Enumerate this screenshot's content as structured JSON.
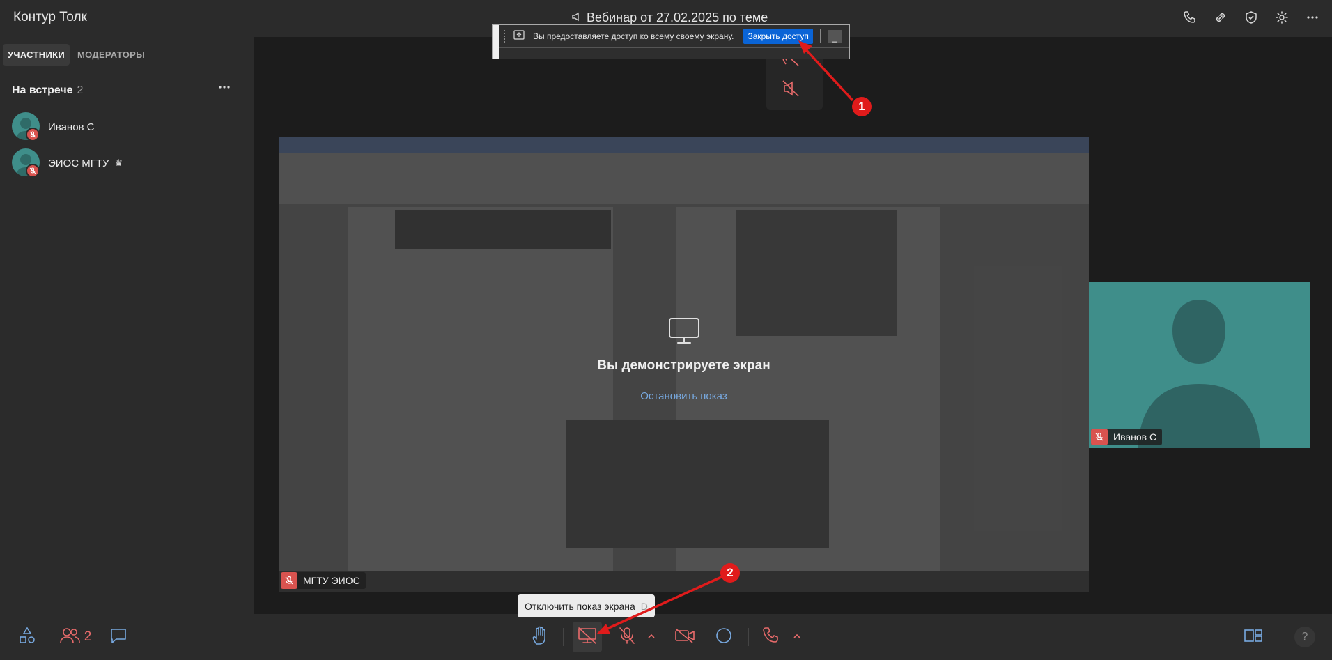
{
  "app": {
    "title": "Контур Толк"
  },
  "meeting": {
    "title": "Вебинар от 27.02.2025 по теме"
  },
  "header_icons": [
    "phone-icon",
    "link-icon",
    "shield-check-icon",
    "gear-icon",
    "more-icon"
  ],
  "sidebar": {
    "tabs": [
      {
        "label": "УЧАСТНИКИ",
        "active": true
      },
      {
        "label": "МОДЕРАТОРЫ",
        "active": false
      }
    ],
    "section": {
      "title": "На встрече",
      "count": "2"
    },
    "participants": [
      {
        "name": "Иванов С",
        "muted": true
      },
      {
        "name": "ЭИОС МГТУ",
        "muted": true,
        "host": true,
        "host_icon": "♛"
      }
    ]
  },
  "share_banner": {
    "message": "Вы предоставляете доступ ко всему своему экрану.",
    "close_label": "Закрыть доступ",
    "minimize_label": "_"
  },
  "screen_share": {
    "title": "Вы демонстрируете экран",
    "stop_label": "Остановить показ",
    "owner": "МГТУ ЭИОС"
  },
  "video_tile": {
    "name": "Иванов С"
  },
  "toolbar": {
    "participants_count": "2",
    "tooltip": "Отключить показ экрана",
    "tooltip_key": "D"
  },
  "callouts": [
    "1",
    "2"
  ],
  "colors": {
    "accent_red": "#e86b6b",
    "accent_blue": "#78a9e0",
    "teal": "#3f8e8a",
    "panel": "#2b2b2b",
    "callout_red": "#e01b1b",
    "banner_button": "#0a64d6"
  }
}
